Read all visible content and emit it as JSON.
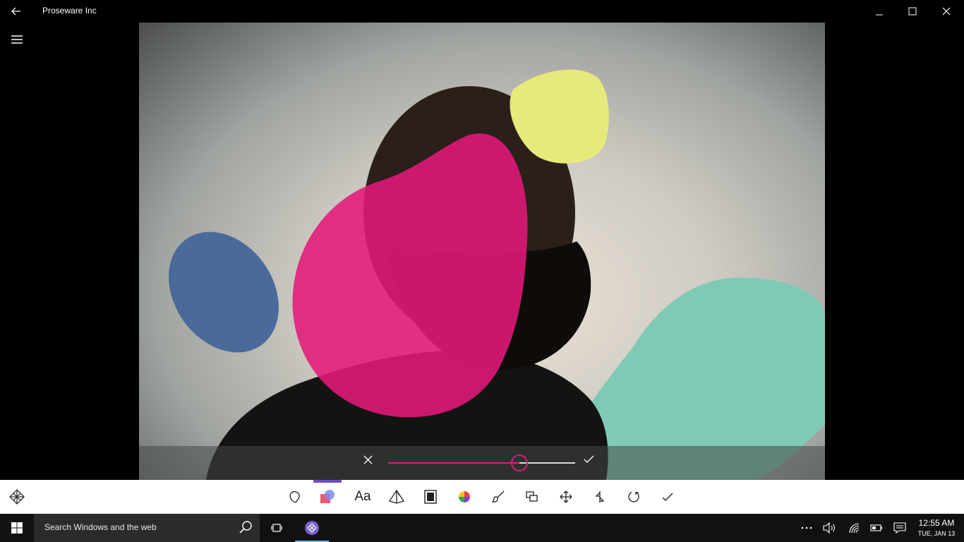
{
  "window": {
    "title": "Proseware Inc"
  },
  "editor": {
    "slider": {
      "value_percent": 70
    }
  },
  "toolbar": {
    "text_tool_label": "Aa",
    "active_tool": "layers"
  },
  "taskbar": {
    "search_placeholder": "Search Windows and the web",
    "time": "12:55 AM",
    "date": "TUE, JAN 13"
  },
  "colors": {
    "accent": "#e3197a",
    "active_indicator": "#6b4fbb",
    "shape_pink": "#e3197a",
    "shape_yellow": "#e6ea7a",
    "shape_blue": "#4a6a9a",
    "shape_mint": "#7fcab5"
  }
}
